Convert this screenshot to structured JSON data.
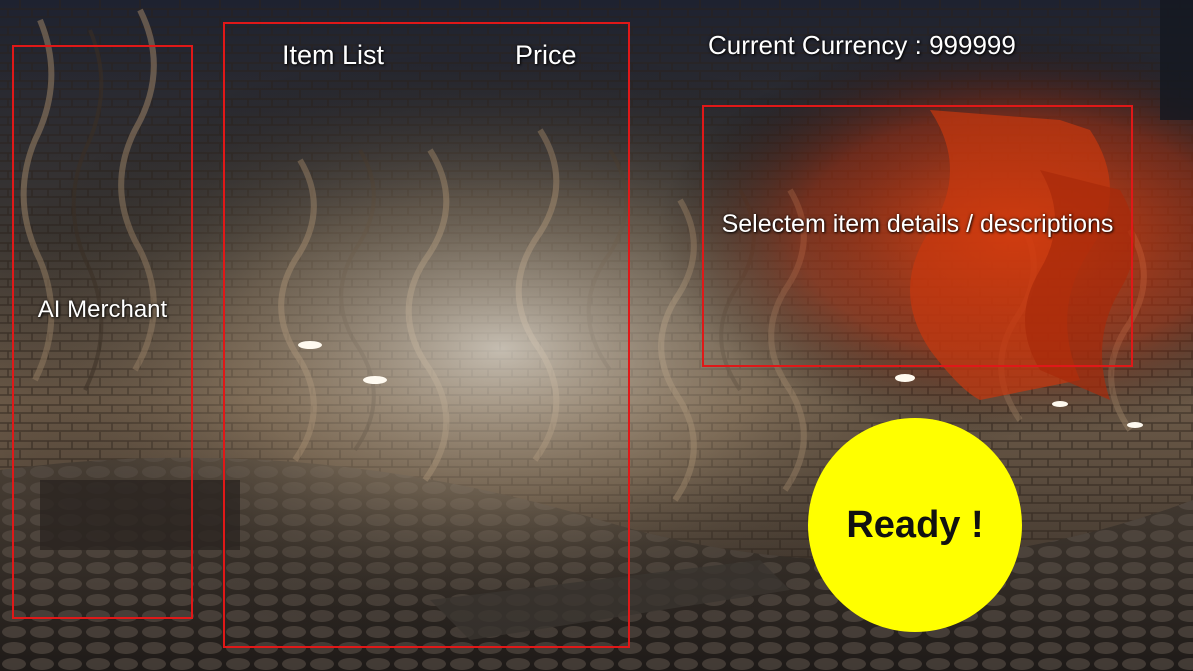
{
  "hud": {
    "currency_label": "Current Currency : 999999",
    "ready_label": "Ready !"
  },
  "merchant_panel": {
    "label": "AI Merchant"
  },
  "item_list_panel": {
    "item_list_header": "Item List",
    "price_header": "Price"
  },
  "details_panel": {
    "label": "Selectem item details / descriptions"
  },
  "colors": {
    "box_border": "#e01818",
    "ready_fill": "#ffff00",
    "label_text": "#ffffff"
  }
}
